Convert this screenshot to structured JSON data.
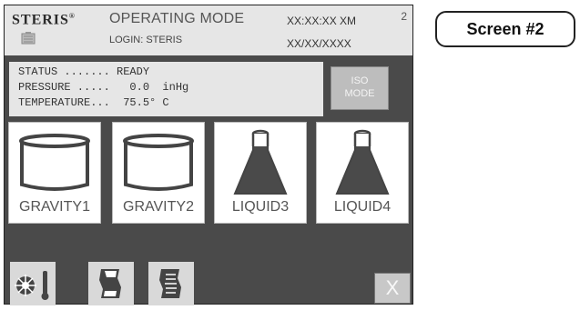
{
  "header": {
    "brand": "STERIS",
    "brand_mark": "®",
    "mode_title": "OPERATING MODE",
    "login": "LOGIN: STERIS",
    "time": "XX:XX:XX XM",
    "date": "XX/XX/XXXX",
    "screen_number": "2"
  },
  "status_panel": {
    "lines": [
      "STATUS ....... READY",
      "PRESSURE .....   0.0  inHg",
      "TEMPERATURE...  75.5° C"
    ]
  },
  "iso_button": {
    "line1": "ISO",
    "line2": "MODE"
  },
  "cycles": [
    {
      "label": "GRAVITY1",
      "icon": "chamber-icon"
    },
    {
      "label": "GRAVITY2",
      "icon": "chamber-icon"
    },
    {
      "label": "LIQUID3",
      "icon": "flask-icon"
    },
    {
      "label": "LIQUID4",
      "icon": "flask-icon"
    }
  ],
  "toolbar": [
    {
      "icon": "gauge-thermometer-icon"
    },
    {
      "icon": "printout-icon"
    },
    {
      "icon": "printout-lines-icon"
    }
  ],
  "close_button": {
    "label": "X"
  },
  "callout": {
    "label": "Screen #2"
  }
}
